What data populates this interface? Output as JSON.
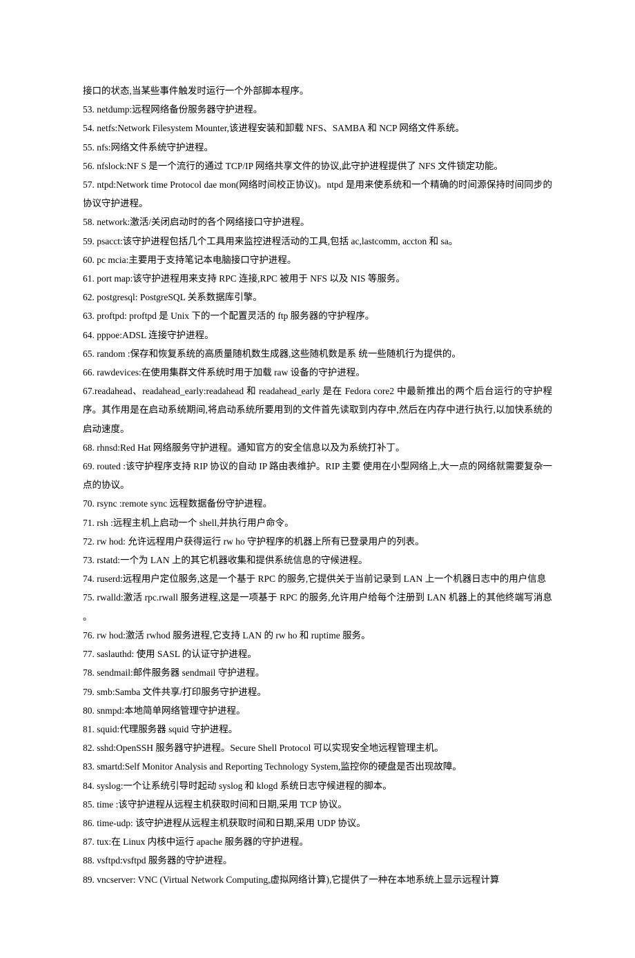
{
  "lines": [
    "接口的状态,当某些事件触发时运行一个外部脚本程序。",
    "53. netdump:远程网络备份服务器守护进程。",
    "54. netfs:Network Filesystem Mounter,该进程安装和卸载 NFS、SAMBA 和 NCP 网络文件系统。",
    "55. nfs:网络文件系统守护进程。",
    "56. nfslock:NF S 是一个流行的通过 TCP/IP 网络共享文件的协议,此守护进程提供了 NFS 文件锁定功能。",
    "57. ntpd:Network time Protocol dae mon(网络时间校正协议)。ntpd 是用来使系统和一个精确的时间源保持时间同步的协议守护进程。",
    "58. network:激活/关闭启动时的各个网络接口守护进程。",
    "59. psacct:该守护进程包括几个工具用来监控进程活动的工具,包括 ac,lastcomm, accton 和 sa。",
    "60. pc mcia:主要用于支持笔记本电脑接口守护进程。",
    "61. port map:该守护进程用来支持 RPC 连接,RPC 被用于 NFS 以及 NIS 等服务。",
    "62. postgresql: PostgreSQL 关系数据库引擎。",
    "63. proftpd: proftpd 是 Unix 下的一个配置灵活的 ftp 服务器的守护程序。",
    "64. pppoe:ADSL 连接守护进程。",
    "65. random :保存和恢复系统的高质量随机数生成器,这些随机数是系 统一些随机行为提供的。",
    "66. rawdevices:在使用集群文件系统时用于加载 raw 设备的守护进程。",
    "67.readahead、readahead_early:readahead 和 readahead_early 是在 Fedora core2 中最新推出的两个后台运行的守护程序。其作用是在启动系统期间,将启动系统所要用到的文件首先读取到内存中,然后在内存中进行执行,以加快系统的启动速度。",
    "68. rhnsd:Red Hat 网络服务守护进程。通知官方的安全信息以及为系统打补丁。",
    "69. routed :该守护程序支持 RIP 协议的自动 IP 路由表维护。RIP 主要 使用在小型网络上,大一点的网络就需要复杂一点的协议。",
    "70. rsync :remote sync 远程数据备份守护进程。",
    "71. rsh :远程主机上启动一个 shell,并执行用户命令。",
    "72. rw hod: 允许远程用户获得运行 rw ho 守护程序的机器上所有已登录用户的列表。",
    "73. rstatd:一个为 LAN 上的其它机器收集和提供系统信息的守候进程。",
    "74. ruserd:远程用户定位服务,这是一个基于 RPC 的服务,它提供关于当前记录到 LAN 上一个机器日志中的用户信息",
    "75. rwalld:激活 rpc.rwall 服务进程,这是一项基于 RPC 的服务,允许用户给每个注册到 LAN 机器上的其他终端写消息 。",
    "76. rw hod:激活 rwhod 服务进程,它支持 LAN 的 rw ho 和 ruptime 服务。",
    "77. saslauthd: 使用 SASL 的认证守护进程。",
    "78. sendmail:邮件服务器 sendmail 守护进程。",
    "79. smb:Samba 文件共享/打印服务守护进程。",
    "80. snmpd:本地简单网络管理守护进程。",
    "81. squid:代理服务器 squid 守护进程。",
    "82. sshd:OpenSSH 服务器守护进程。Secure Shell Protocol 可以实现安全地远程管理主机。",
    "83. smartd:Self Monitor Analysis and Reporting Technology System,监控你的硬盘是否出现故障。",
    "84. syslog:一个让系统引导时起动 syslog 和 klogd 系统日志守候进程的脚本。",
    "85. time :该守护进程从远程主机获取时间和日期,采用 TCP 协议。",
    "86. time-udp: 该守护进程从远程主机获取时间和日期,采用 UDP 协议。",
    "87. tux:在 Linux 内核中运行 apache 服务器的守护进程。",
    "88. vsftpd:vsftpd 服务器的守护进程。",
    "89. vncserver: VNC (Virtual Network Computing,虚拟网络计算),它提供了一种在本地系统上显示远程计算"
  ]
}
